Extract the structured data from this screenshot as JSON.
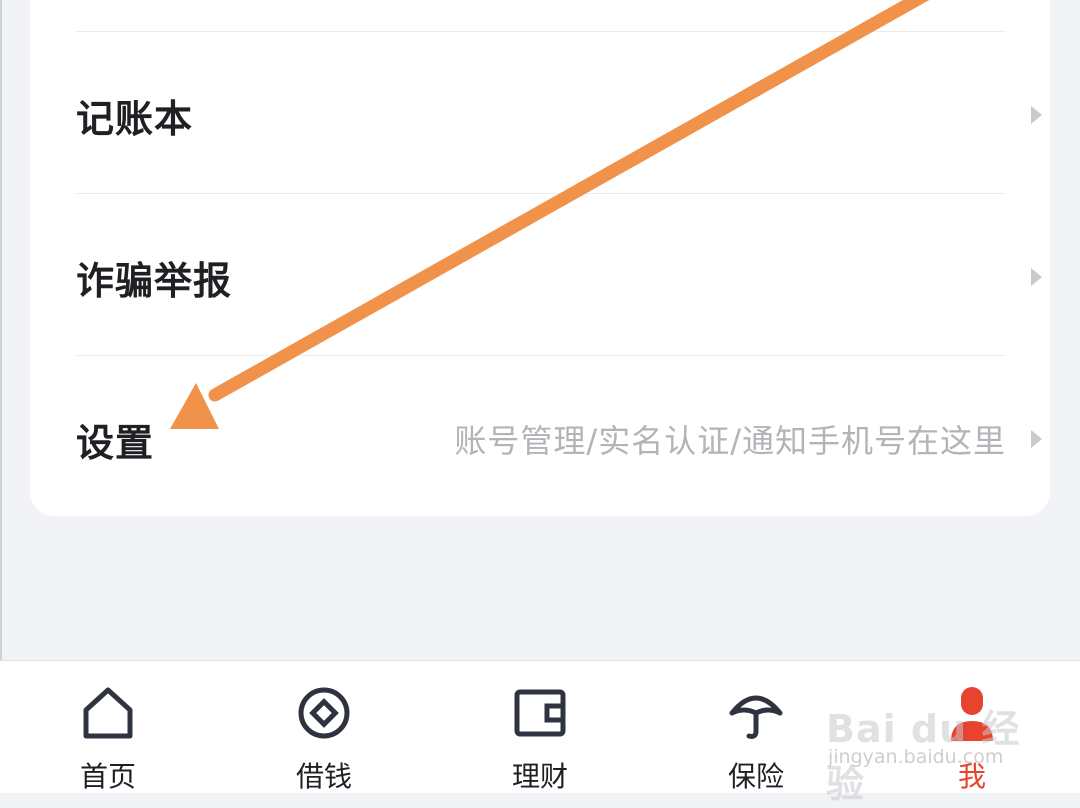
{
  "menu": {
    "items": [
      {
        "label": "记账本",
        "hint": ""
      },
      {
        "label": "诈骗举报",
        "hint": ""
      },
      {
        "label": "设置",
        "hint": "账号管理/实名认证/通知手机号在这里"
      }
    ]
  },
  "annotation": {
    "color": "#f0924a"
  },
  "tabbar": {
    "active_color": "#e8432f",
    "tabs": [
      {
        "label": "首页",
        "icon": "home-icon"
      },
      {
        "label": "借钱",
        "icon": "coin-icon"
      },
      {
        "label": "理财",
        "icon": "wallet-icon"
      },
      {
        "label": "保险",
        "icon": "umbrella-icon"
      },
      {
        "label": "我",
        "icon": "person-icon",
        "active": true
      }
    ]
  },
  "watermark": {
    "main": "Bai du 经验",
    "sub": "jingyan.baidu.com"
  }
}
